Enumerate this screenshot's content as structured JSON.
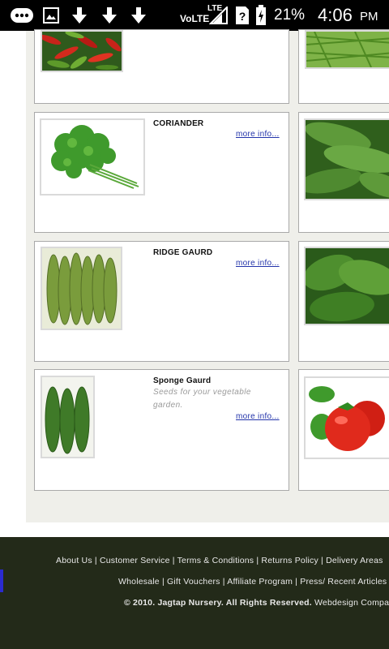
{
  "status_bar": {
    "volte": "VoLTE",
    "lte": "LTE",
    "battery": "21%",
    "time": "4:06",
    "ampm": "PM",
    "icons": [
      "chat-bubble-icon",
      "image-icon",
      "download-icon",
      "download-icon",
      "download-icon",
      "signal-icon",
      "sim-unknown-icon",
      "battery-icon"
    ]
  },
  "products": [
    {
      "title": "CORIANDER",
      "link": "more info..."
    },
    {
      "title": "RIDGE GAURD",
      "link": "more info..."
    },
    {
      "title": "Sponge Gaurd",
      "description": "Seeds for your vegetable garden.",
      "link": "more info..."
    }
  ],
  "footer": {
    "line1": [
      "About Us",
      "Customer Service",
      "Terms & Conditions",
      "Returns Policy",
      "Delivery Areas"
    ],
    "line2": [
      "Wholesale",
      "Gift Vouchers",
      "Affiliate Program",
      "Press/ Recent Articles"
    ],
    "copyright": "© 2010. Jagtap Nursery. All Rights Reserved.",
    "credit": "Webdesign Company"
  },
  "colors": {
    "footer_bg": "#232a19",
    "link_blue": "#2233aa",
    "panel_gray": "#efefea"
  }
}
